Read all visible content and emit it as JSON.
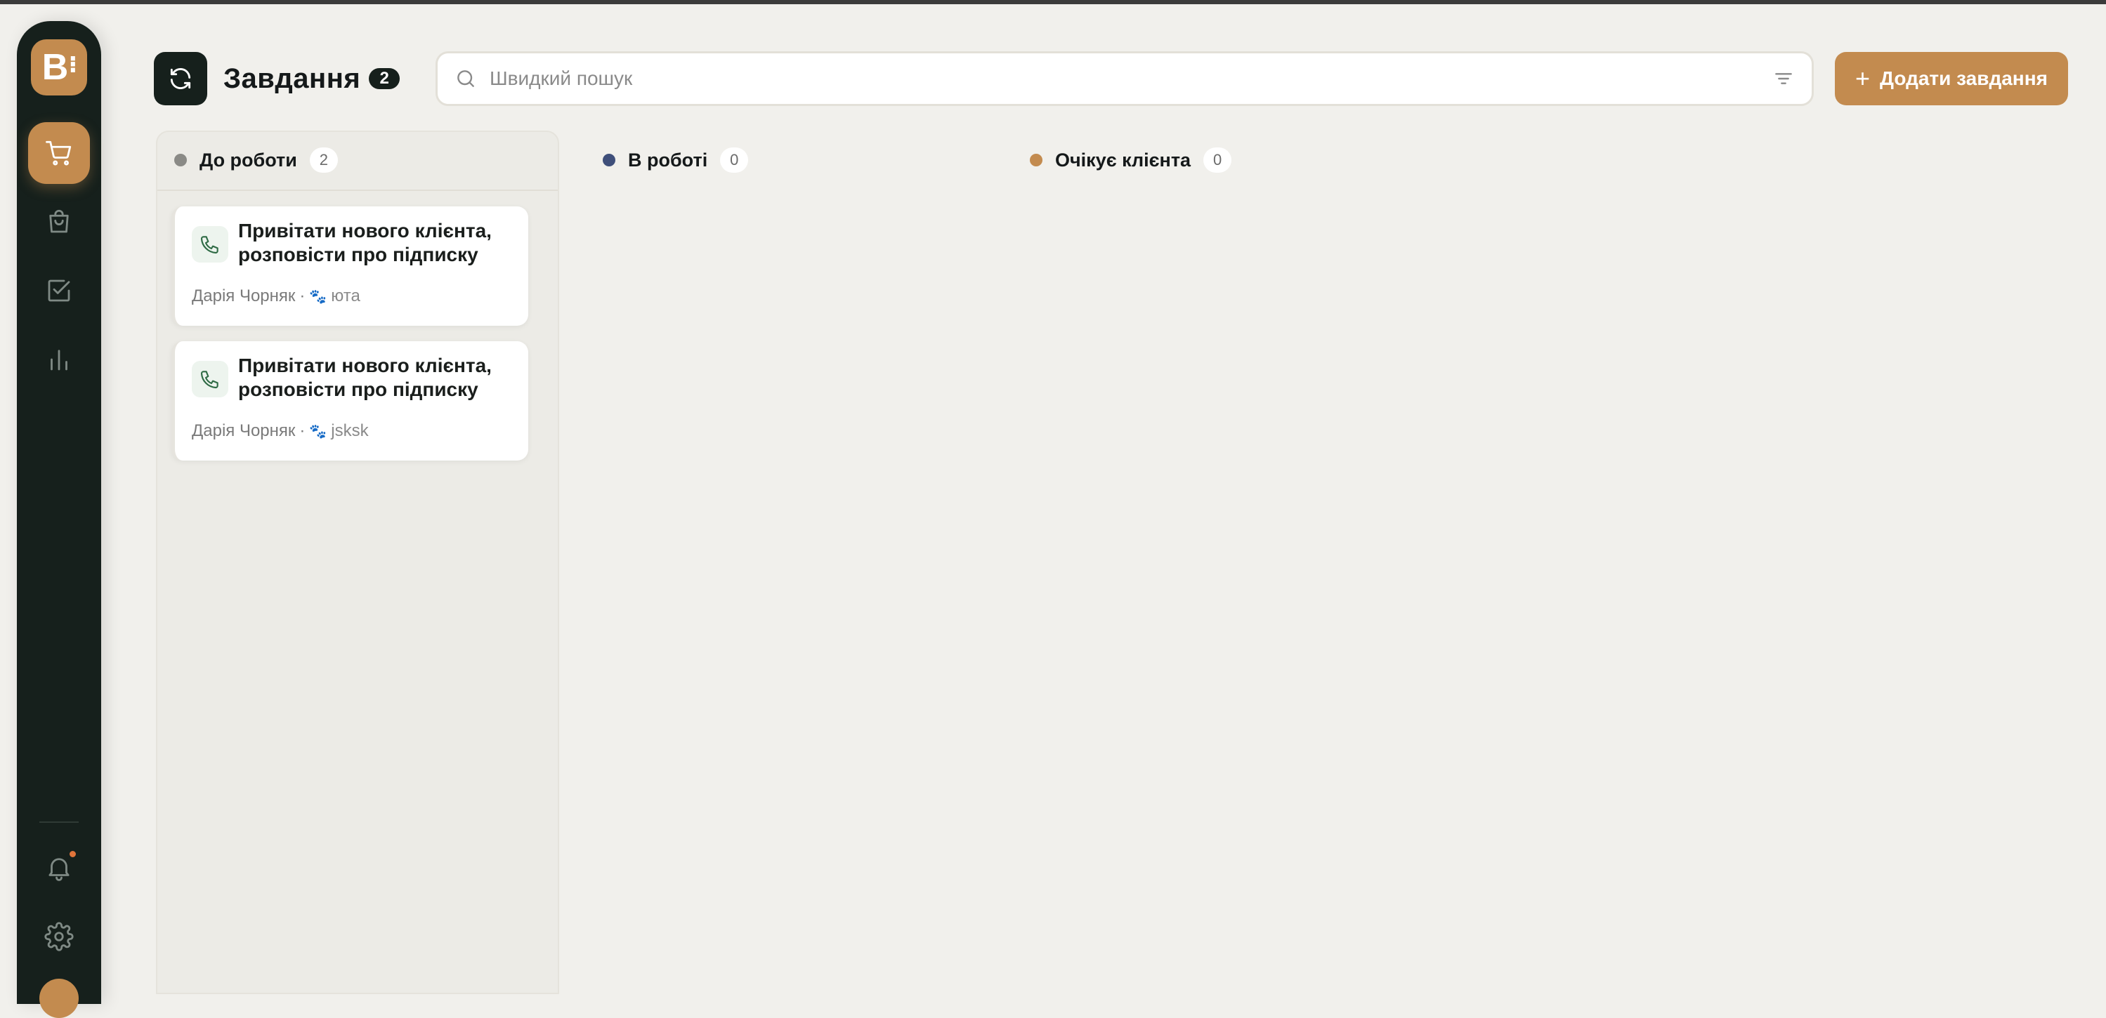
{
  "header": {
    "title": "Завдання",
    "count": "2",
    "search_placeholder": "Швидкий пошук",
    "add_button_label": "Додати завдання"
  },
  "sidebar": {
    "logo_text": "B",
    "items": [
      {
        "name": "cart-icon",
        "active": true
      },
      {
        "name": "bag-icon",
        "active": false
      },
      {
        "name": "checkbox-icon",
        "active": false
      },
      {
        "name": "bar-chart-icon",
        "active": false
      },
      {
        "name": "bell-icon",
        "active": false
      },
      {
        "name": "gear-icon",
        "active": false
      }
    ]
  },
  "columns": [
    {
      "title": "До роботи",
      "count": "2",
      "color": "#8a8a86"
    },
    {
      "title": "В роботі",
      "count": "0",
      "color": "#3f4f7a"
    },
    {
      "title": "Очікує клієнта",
      "count": "0",
      "color": "#c38b4f"
    }
  ],
  "cards": [
    {
      "title": "Привітати нового клієнта, розповісти про підписку",
      "assignee": "Дарія Чорняк",
      "separator": "·",
      "pet": "юта",
      "icon": "phone-icon"
    },
    {
      "title": "Привітати нового клієнта, розповісти про підписку",
      "assignee": "Дарія Чорняк",
      "separator": "·",
      "pet": "jsksk",
      "icon": "phone-icon"
    }
  ],
  "colors": {
    "accent": "#c38b4f",
    "sidebar": "#16201c",
    "background": "#f1f0ec"
  }
}
